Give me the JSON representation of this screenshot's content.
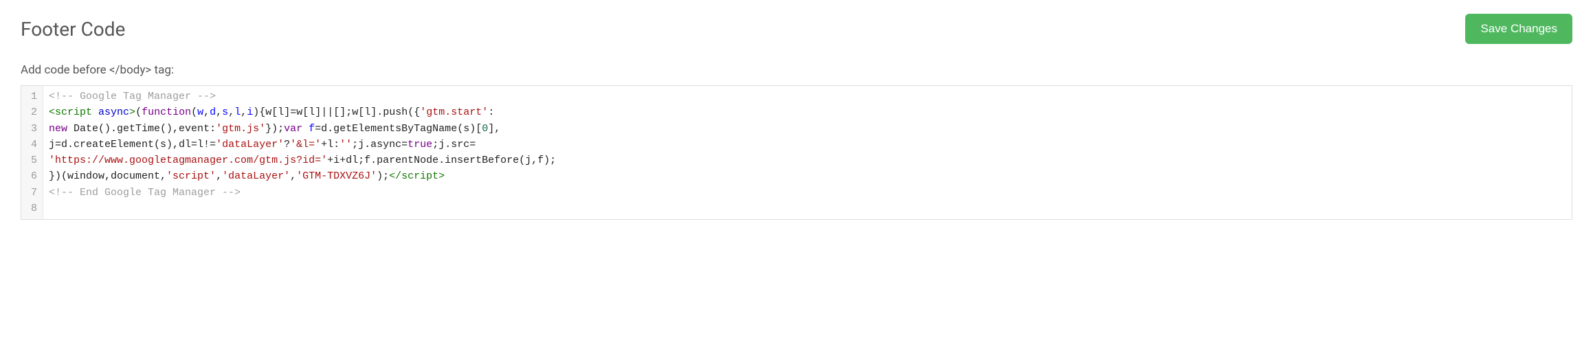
{
  "header": {
    "title": "Footer Code",
    "save_label": "Save Changes"
  },
  "field": {
    "label": "Add code before </body> tag:"
  },
  "editor": {
    "line_numbers": [
      "1",
      "2",
      "3",
      "4",
      "5",
      "6",
      "7",
      "8"
    ],
    "lines": [
      [
        {
          "cls": "tok-comment",
          "text": "<!-- Google Tag Manager -->"
        }
      ],
      [
        {
          "cls": "tok-tag",
          "text": "<script "
        },
        {
          "cls": "tok-attr",
          "text": "async"
        },
        {
          "cls": "tok-tag",
          "text": ">"
        },
        {
          "cls": "",
          "text": "("
        },
        {
          "cls": "tok-kw",
          "text": "function"
        },
        {
          "cls": "",
          "text": "("
        },
        {
          "cls": "tok-def",
          "text": "w"
        },
        {
          "cls": "",
          "text": ","
        },
        {
          "cls": "tok-def",
          "text": "d"
        },
        {
          "cls": "",
          "text": ","
        },
        {
          "cls": "tok-def",
          "text": "s"
        },
        {
          "cls": "",
          "text": ","
        },
        {
          "cls": "tok-def",
          "text": "l"
        },
        {
          "cls": "",
          "text": ","
        },
        {
          "cls": "tok-def",
          "text": "i"
        },
        {
          "cls": "",
          "text": "){w[l]=w[l]||[];w[l].push({"
        },
        {
          "cls": "tok-str",
          "text": "'gtm.start'"
        },
        {
          "cls": "",
          "text": ":"
        }
      ],
      [
        {
          "cls": "tok-kw",
          "text": "new"
        },
        {
          "cls": "",
          "text": " Date().getTime(),event:"
        },
        {
          "cls": "tok-str",
          "text": "'gtm.js'"
        },
        {
          "cls": "",
          "text": "});"
        },
        {
          "cls": "tok-kw",
          "text": "var"
        },
        {
          "cls": "",
          "text": " "
        },
        {
          "cls": "tok-def",
          "text": "f"
        },
        {
          "cls": "",
          "text": "=d.getElementsByTagName(s)["
        },
        {
          "cls": "tok-num",
          "text": "0"
        },
        {
          "cls": "",
          "text": "],"
        }
      ],
      [
        {
          "cls": "",
          "text": "j=d.createElement(s),dl=l!="
        },
        {
          "cls": "tok-str",
          "text": "'dataLayer'"
        },
        {
          "cls": "",
          "text": "?"
        },
        {
          "cls": "tok-str",
          "text": "'&l='"
        },
        {
          "cls": "",
          "text": "+l:"
        },
        {
          "cls": "tok-str",
          "text": "''"
        },
        {
          "cls": "",
          "text": ";j.async="
        },
        {
          "cls": "tok-kw",
          "text": "true"
        },
        {
          "cls": "",
          "text": ";j.src="
        }
      ],
      [
        {
          "cls": "tok-str",
          "text": "'https://www.googletagmanager.com/gtm.js?id='"
        },
        {
          "cls": "",
          "text": "+i+dl;f.parentNode.insertBefore(j,f);"
        }
      ],
      [
        {
          "cls": "",
          "text": "})(window,document,"
        },
        {
          "cls": "tok-str",
          "text": "'script'"
        },
        {
          "cls": "",
          "text": ","
        },
        {
          "cls": "tok-str",
          "text": "'dataLayer'"
        },
        {
          "cls": "",
          "text": ","
        },
        {
          "cls": "tok-str",
          "text": "'GTM-TDXVZ6J'"
        },
        {
          "cls": "",
          "text": ");"
        },
        {
          "cls": "tok-tag",
          "text": "</script>"
        }
      ],
      [
        {
          "cls": "tok-comment",
          "text": "<!-- End Google Tag Manager -->"
        }
      ],
      [
        {
          "cls": "",
          "text": ""
        }
      ]
    ]
  }
}
